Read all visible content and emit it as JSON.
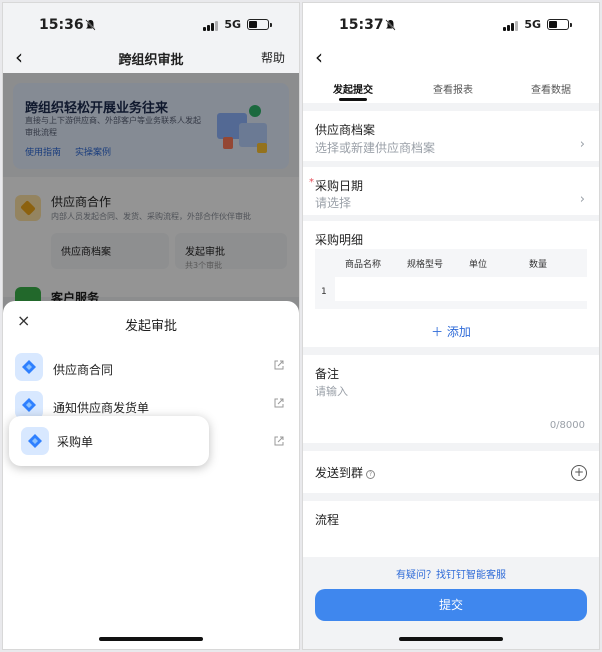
{
  "left": {
    "status_time": "15:36",
    "network": "5G",
    "nav": {
      "back": "‹",
      "title": "跨组织审批",
      "help": "帮助"
    },
    "banner": {
      "title": "跨组织轻松开展业务往来",
      "desc": "直接与上下游供应商、外部客户等业务联系人发起审批流程",
      "link_guide": "使用指南",
      "link_cases": "实操案例"
    },
    "card": {
      "title": "供应商合作",
      "desc": "内部人员发起合同、发货、采购流程，外部合作伙伴审批",
      "btn1": "供应商档案",
      "btn2": "发起审批",
      "btn2_sub": "共3个审批"
    },
    "card2_title": "客户服务",
    "sheet": {
      "close": "×",
      "title": "发起审批",
      "items": [
        "供应商合同",
        "通知供应商发货单",
        "采购单"
      ]
    }
  },
  "right": {
    "status_time": "15:37",
    "network": "5G",
    "back": "‹",
    "tabs": [
      "发起提交",
      "查看报表",
      "查看数据"
    ],
    "supplier": {
      "label": "供应商档案",
      "placeholder": "选择或新建供应商档案"
    },
    "date": {
      "required_mark": "*",
      "label": "采购日期",
      "placeholder": "请选择"
    },
    "details": {
      "label": "采购明细",
      "columns": [
        "商品名称",
        "规格型号",
        "单位",
        "数量"
      ],
      "row_index": "1",
      "add": "添加"
    },
    "remark": {
      "label": "备注",
      "placeholder": "请输入",
      "counter": "0/8000"
    },
    "send_group": {
      "label": "发送到群",
      "help": "?"
    },
    "flow": {
      "label": "流程"
    },
    "help_link": "有疑问？找钉钉智能客服",
    "submit": "提交"
  },
  "colors": {
    "accent": "#3f87ee",
    "link": "#2f6bd8",
    "required": "#e34d59"
  }
}
